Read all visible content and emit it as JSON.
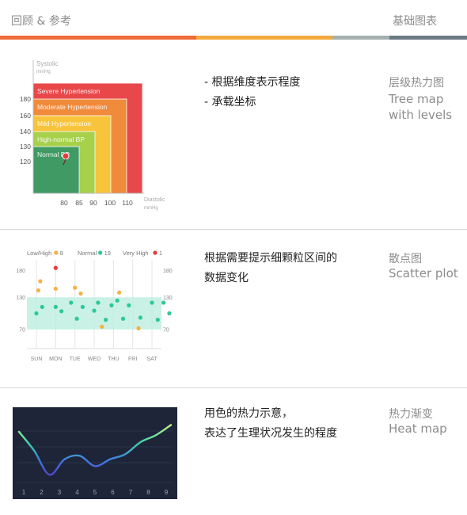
{
  "header": {
    "left": "回顾 & 参考",
    "right": "基础图表",
    "bar_colors": [
      "#ef6c3a",
      "#f4a93e",
      "#a6b0ae",
      "#6c7a83"
    ]
  },
  "sections": [
    {
      "desc": [
        "- 根据维度表示程度",
        "- 承载坐标"
      ],
      "title_cn": "层级热力图",
      "title_en": [
        "Tree map",
        "with levels"
      ]
    },
    {
      "desc": [
        "根据需要提示细颗粒区间的",
        "数据变化"
      ],
      "title_cn": "散点图",
      "title_en": [
        "Scatter plot"
      ]
    },
    {
      "desc": [
        "用色的热力示意，",
        "表达了生理状况发生的程度"
      ],
      "title_cn": "热力渐变",
      "title_en": [
        "Heat map"
      ]
    }
  ],
  "chart_data": [
    {
      "type": "heatmap",
      "ylabel": "Systolic",
      "yunit": "mmHg",
      "xlabel": "Diastolic",
      "xunit": "mmHg",
      "x_ticks": [
        "80",
        "85",
        "90",
        "100",
        "110"
      ],
      "y_ticks": [
        "180",
        "160",
        "140",
        "130",
        "120"
      ],
      "levels": [
        {
          "name": "Severe Hypertension",
          "color": "#e8484a"
        },
        {
          "name": "Moderate Hypertension",
          "color": "#f08b3c"
        },
        {
          "name": "Mild Hypertension",
          "color": "#f8c43c"
        },
        {
          "name": "High-normal BP",
          "color": "#a7d04b"
        },
        {
          "name": "Normal BP",
          "color": "#3f9a63"
        }
      ],
      "marker": {
        "x": 80,
        "y": 120
      }
    },
    {
      "type": "scatter",
      "legend": [
        {
          "label": "Low/High",
          "count": "8",
          "color": "#f6b243"
        },
        {
          "label": "Normal",
          "count": "19",
          "color": "#2ec89a"
        },
        {
          "label": "Very High",
          "count": "1",
          "color": "#e23b3b"
        }
      ],
      "categories": [
        "SUN",
        "MON",
        "TUE",
        "WED",
        "THU",
        "FRI",
        "SAT"
      ],
      "y_ticks": [
        "180",
        "130",
        "70"
      ],
      "normal_band": [
        70,
        130
      ],
      "series": [
        {
          "name": "Normal",
          "color": "#2ec89a",
          "points": [
            [
              0,
              100
            ],
            [
              0.3,
              112
            ],
            [
              1,
              112
            ],
            [
              1.3,
              104
            ],
            [
              1.8,
              120
            ],
            [
              2.1,
              90
            ],
            [
              2.4,
              112
            ],
            [
              3,
              105
            ],
            [
              3.2,
              120
            ],
            [
              3.6,
              88
            ],
            [
              3.9,
              115
            ],
            [
              4.2,
              124
            ],
            [
              4.5,
              90
            ],
            [
              4.8,
              115
            ],
            [
              5.4,
              92
            ],
            [
              6,
              120
            ],
            [
              6.3,
              88
            ],
            [
              6.6,
              120
            ],
            [
              6.9,
              100
            ]
          ]
        },
        {
          "name": "Low/High",
          "color": "#f6b243",
          "points": [
            [
              0.2,
              160
            ],
            [
              0.1,
              143
            ],
            [
              1,
              146
            ],
            [
              2,
              148
            ],
            [
              2.3,
              137
            ],
            [
              3.4,
              75
            ],
            [
              4.3,
              139
            ],
            [
              5.3,
              72
            ]
          ]
        },
        {
          "name": "Very High",
          "color": "#e23b3b",
          "points": [
            [
              1,
              185
            ]
          ]
        }
      ]
    },
    {
      "type": "line",
      "x": [
        1,
        2,
        3,
        4,
        5,
        6,
        7,
        8,
        9
      ],
      "series": [
        {
          "values": [
            2.2,
            1.1,
            -0.3,
            0.6,
            0.8,
            0.2,
            0.6,
            0.9,
            1.6,
            2.0,
            2.6
          ]
        }
      ]
    }
  ]
}
